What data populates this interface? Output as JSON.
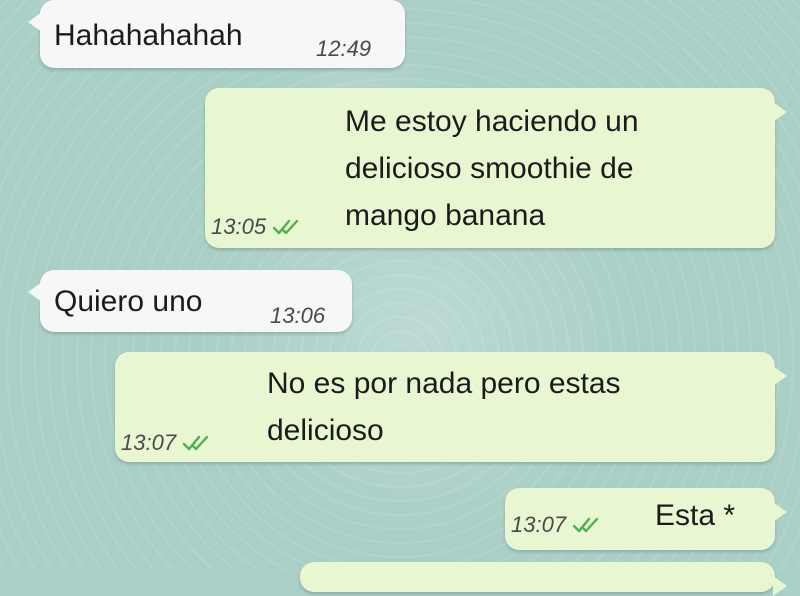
{
  "colors": {
    "wallpaper": "#a9cfc6",
    "incoming_bubble": "#f7f7f7",
    "outgoing_bubble": "#e8f7d2",
    "read_ticks": "#4caf50"
  },
  "messages": [
    {
      "direction": "incoming",
      "text": "Hahahahahah",
      "time": "12:49"
    },
    {
      "direction": "outgoing",
      "text": "Me estoy haciendo un\ndelicioso smoothie de\nmango banana",
      "time": "13:05",
      "status_icon": "double-check-icon"
    },
    {
      "direction": "incoming",
      "text": "Quiero uno",
      "time": "13:06"
    },
    {
      "direction": "outgoing",
      "text": "No es por nada pero estas\ndelicioso",
      "time": "13:07",
      "status_icon": "double-check-icon"
    },
    {
      "direction": "outgoing",
      "text": "Esta *",
      "time": "13:07",
      "status_icon": "double-check-icon"
    }
  ]
}
